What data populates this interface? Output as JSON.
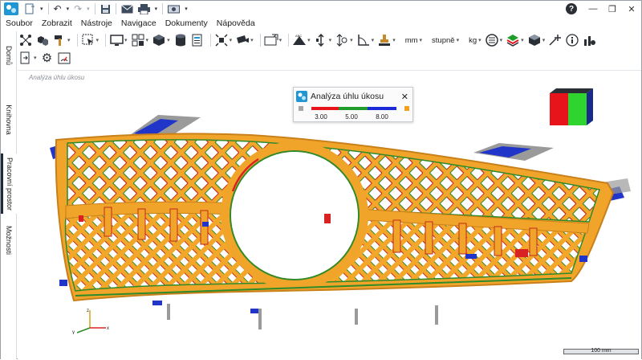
{
  "menu": [
    "Soubor",
    "Zobrazit",
    "Nástroje",
    "Navigace",
    "Dokumenty",
    "Nápověda"
  ],
  "units": {
    "length": "mm",
    "angle": "stupně",
    "mass": "kg"
  },
  "side_tabs": [
    "Domů",
    "Knihovna",
    "Pracovní prostor",
    "Možnosti"
  ],
  "viewport": {
    "label": "Analýza úhlu úkosu"
  },
  "panel": {
    "title": "Analýza úhlu úkosu",
    "close": "✕",
    "ticks": [
      "3.00",
      "5.00",
      "8.00"
    ],
    "colors": {
      "below": "#a6a6a6",
      "low": "#e8141c",
      "mid": "#1f9c2a",
      "high": "#1a2ad6",
      "above": "#f0a11e"
    }
  },
  "axes": {
    "x": "x",
    "y": "y",
    "z": "z"
  },
  "scale": {
    "label": "100 mm"
  },
  "colors": {
    "part": "#f0a52a",
    "part_dark": "#c9801a",
    "draft_green": "#2f8a2a",
    "draft_red": "#d92323",
    "draft_blue": "#2136c8",
    "grey": "#9a9a9a"
  }
}
